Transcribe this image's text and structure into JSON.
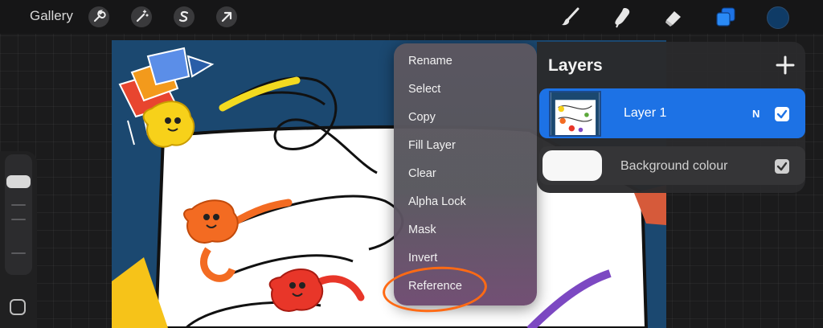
{
  "topbar": {
    "gallery_label": "Gallery",
    "left_tools": [
      "wrench-icon",
      "magic-wand-icon",
      "selection-s-icon",
      "transform-arrow-icon"
    ],
    "right_tools": [
      "brush-icon",
      "smudge-icon",
      "eraser-icon",
      "layers-icon"
    ],
    "active_tool": "layers-icon",
    "accent_color": "#1d72e5",
    "current_color": "#0f3b66"
  },
  "context_menu": {
    "items": [
      "Rename",
      "Select",
      "Copy",
      "Fill Layer",
      "Clear",
      "Alpha Lock",
      "Mask",
      "Invert",
      "Reference"
    ],
    "highlighted_item": "Reference",
    "annotation_color": "#ff6a14"
  },
  "layers_panel": {
    "title": "Layers",
    "add_icon": "plus-icon",
    "layers": [
      {
        "name": "Layer 1",
        "blend_mode": "N",
        "visible": true,
        "selected": true
      }
    ],
    "background": {
      "name": "Background colour",
      "visible": true,
      "color": "#f7f7f7"
    }
  }
}
